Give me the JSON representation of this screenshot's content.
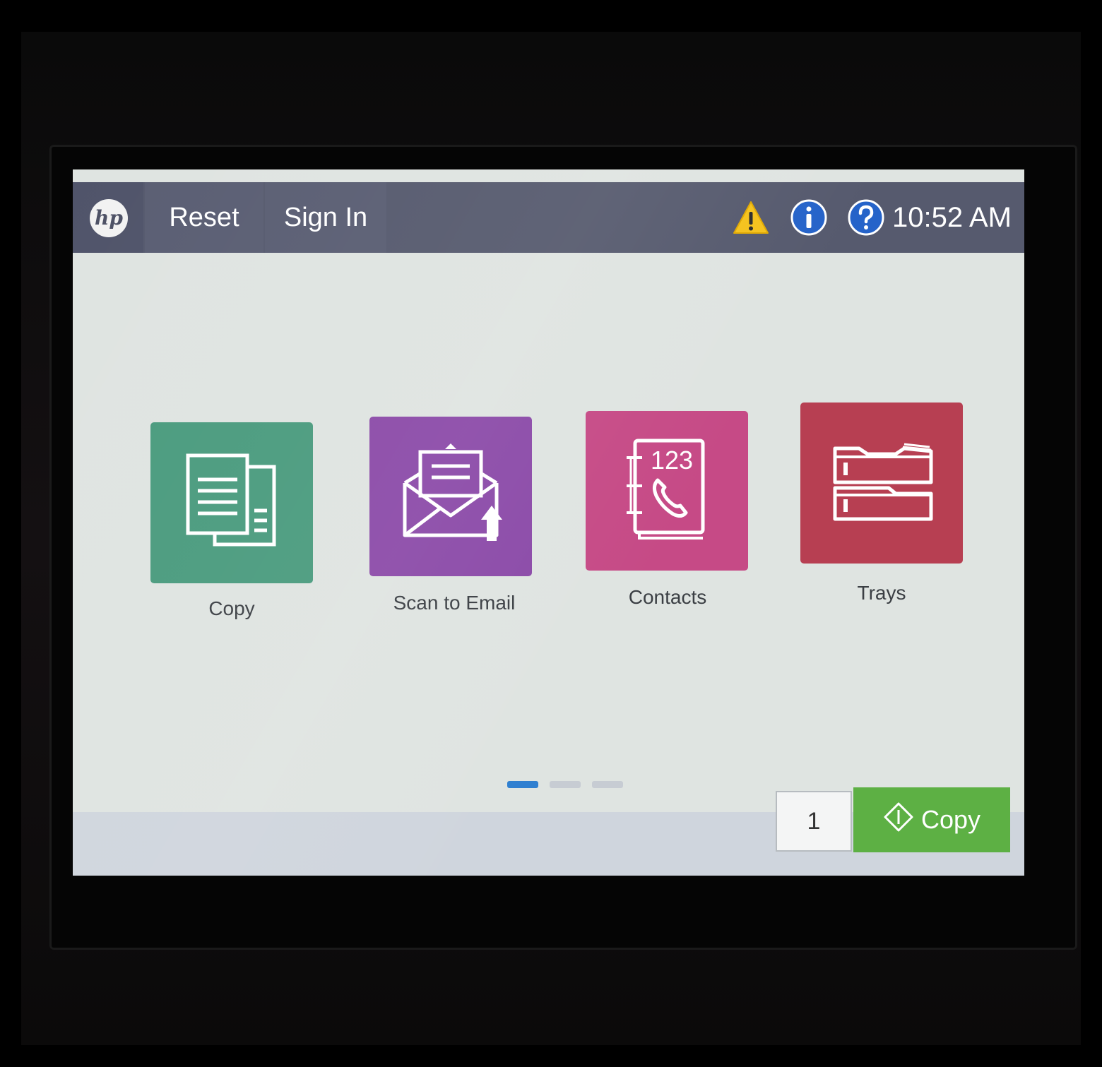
{
  "topbar": {
    "logo": "hp",
    "reset_label": "Reset",
    "signin_label": "Sign In",
    "time": "10:52 AM",
    "status_icons": [
      "warning-icon",
      "info-icon",
      "help-icon"
    ]
  },
  "apps": [
    {
      "label": "Copy",
      "icon": "copy-icon",
      "color": "#4a9b7e"
    },
    {
      "label": "Scan to Email",
      "icon": "scan-to-email-icon",
      "color": "#8b4aa8"
    },
    {
      "label": "Contacts",
      "icon": "contacts-icon",
      "color": "#c64a86",
      "icon_text": "123"
    },
    {
      "label": "Trays",
      "icon": "trays-icon",
      "color": "#b73f52"
    }
  ],
  "pager": {
    "pages": 3,
    "active": 1,
    "active_color": "#2f7fd0"
  },
  "bottom": {
    "copies": "1",
    "start_label": "Copy",
    "start_color": "#5db044"
  },
  "hardware": {
    "home_icon": "home-icon"
  }
}
